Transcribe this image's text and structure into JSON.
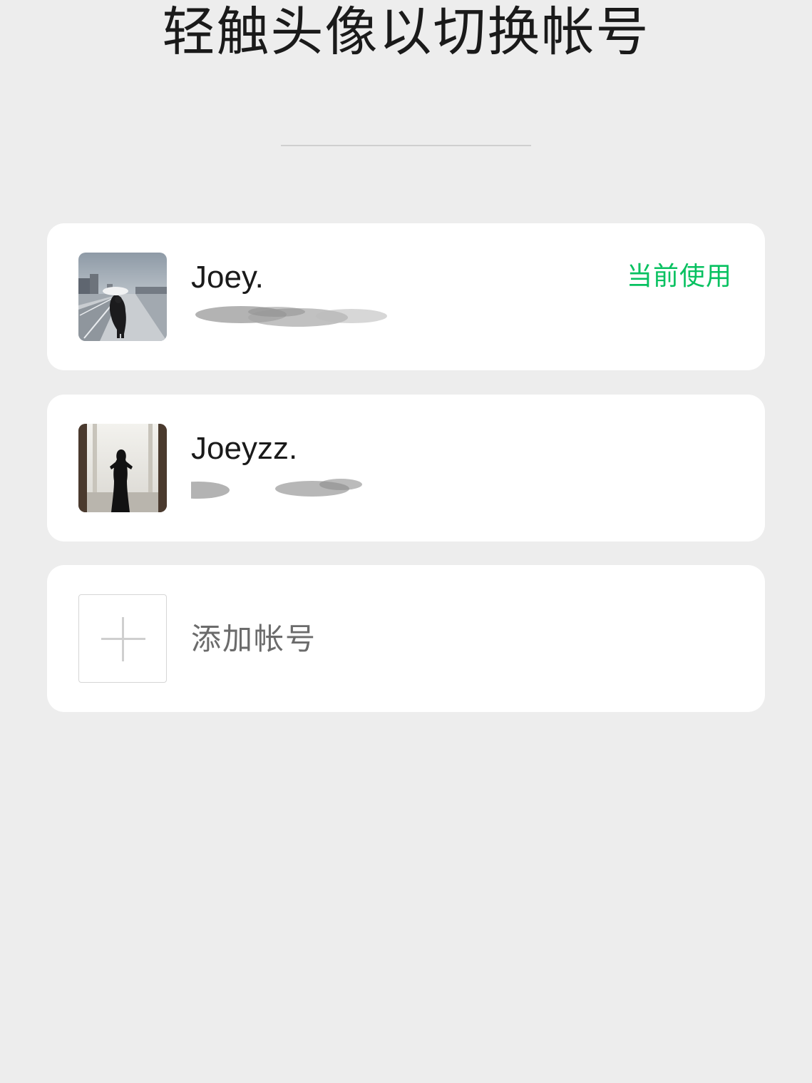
{
  "header": {
    "title": "轻触头像以切换帐号"
  },
  "accounts": [
    {
      "name": "Joey.",
      "status": "当前使用",
      "id_masked": true,
      "avatar": "photo-person-with-umbrella-on-pier"
    },
    {
      "name": "Joeyzz.",
      "id_masked": true,
      "avatar": "photo-person-silhouette-window"
    }
  ],
  "add_account": {
    "label": "添加帐号",
    "icon": "plus-icon"
  },
  "colors": {
    "background": "#ededed",
    "card": "#ffffff",
    "accent_green": "#07c160",
    "text_primary": "#1a1a1a",
    "text_secondary": "#6b6b6b"
  }
}
